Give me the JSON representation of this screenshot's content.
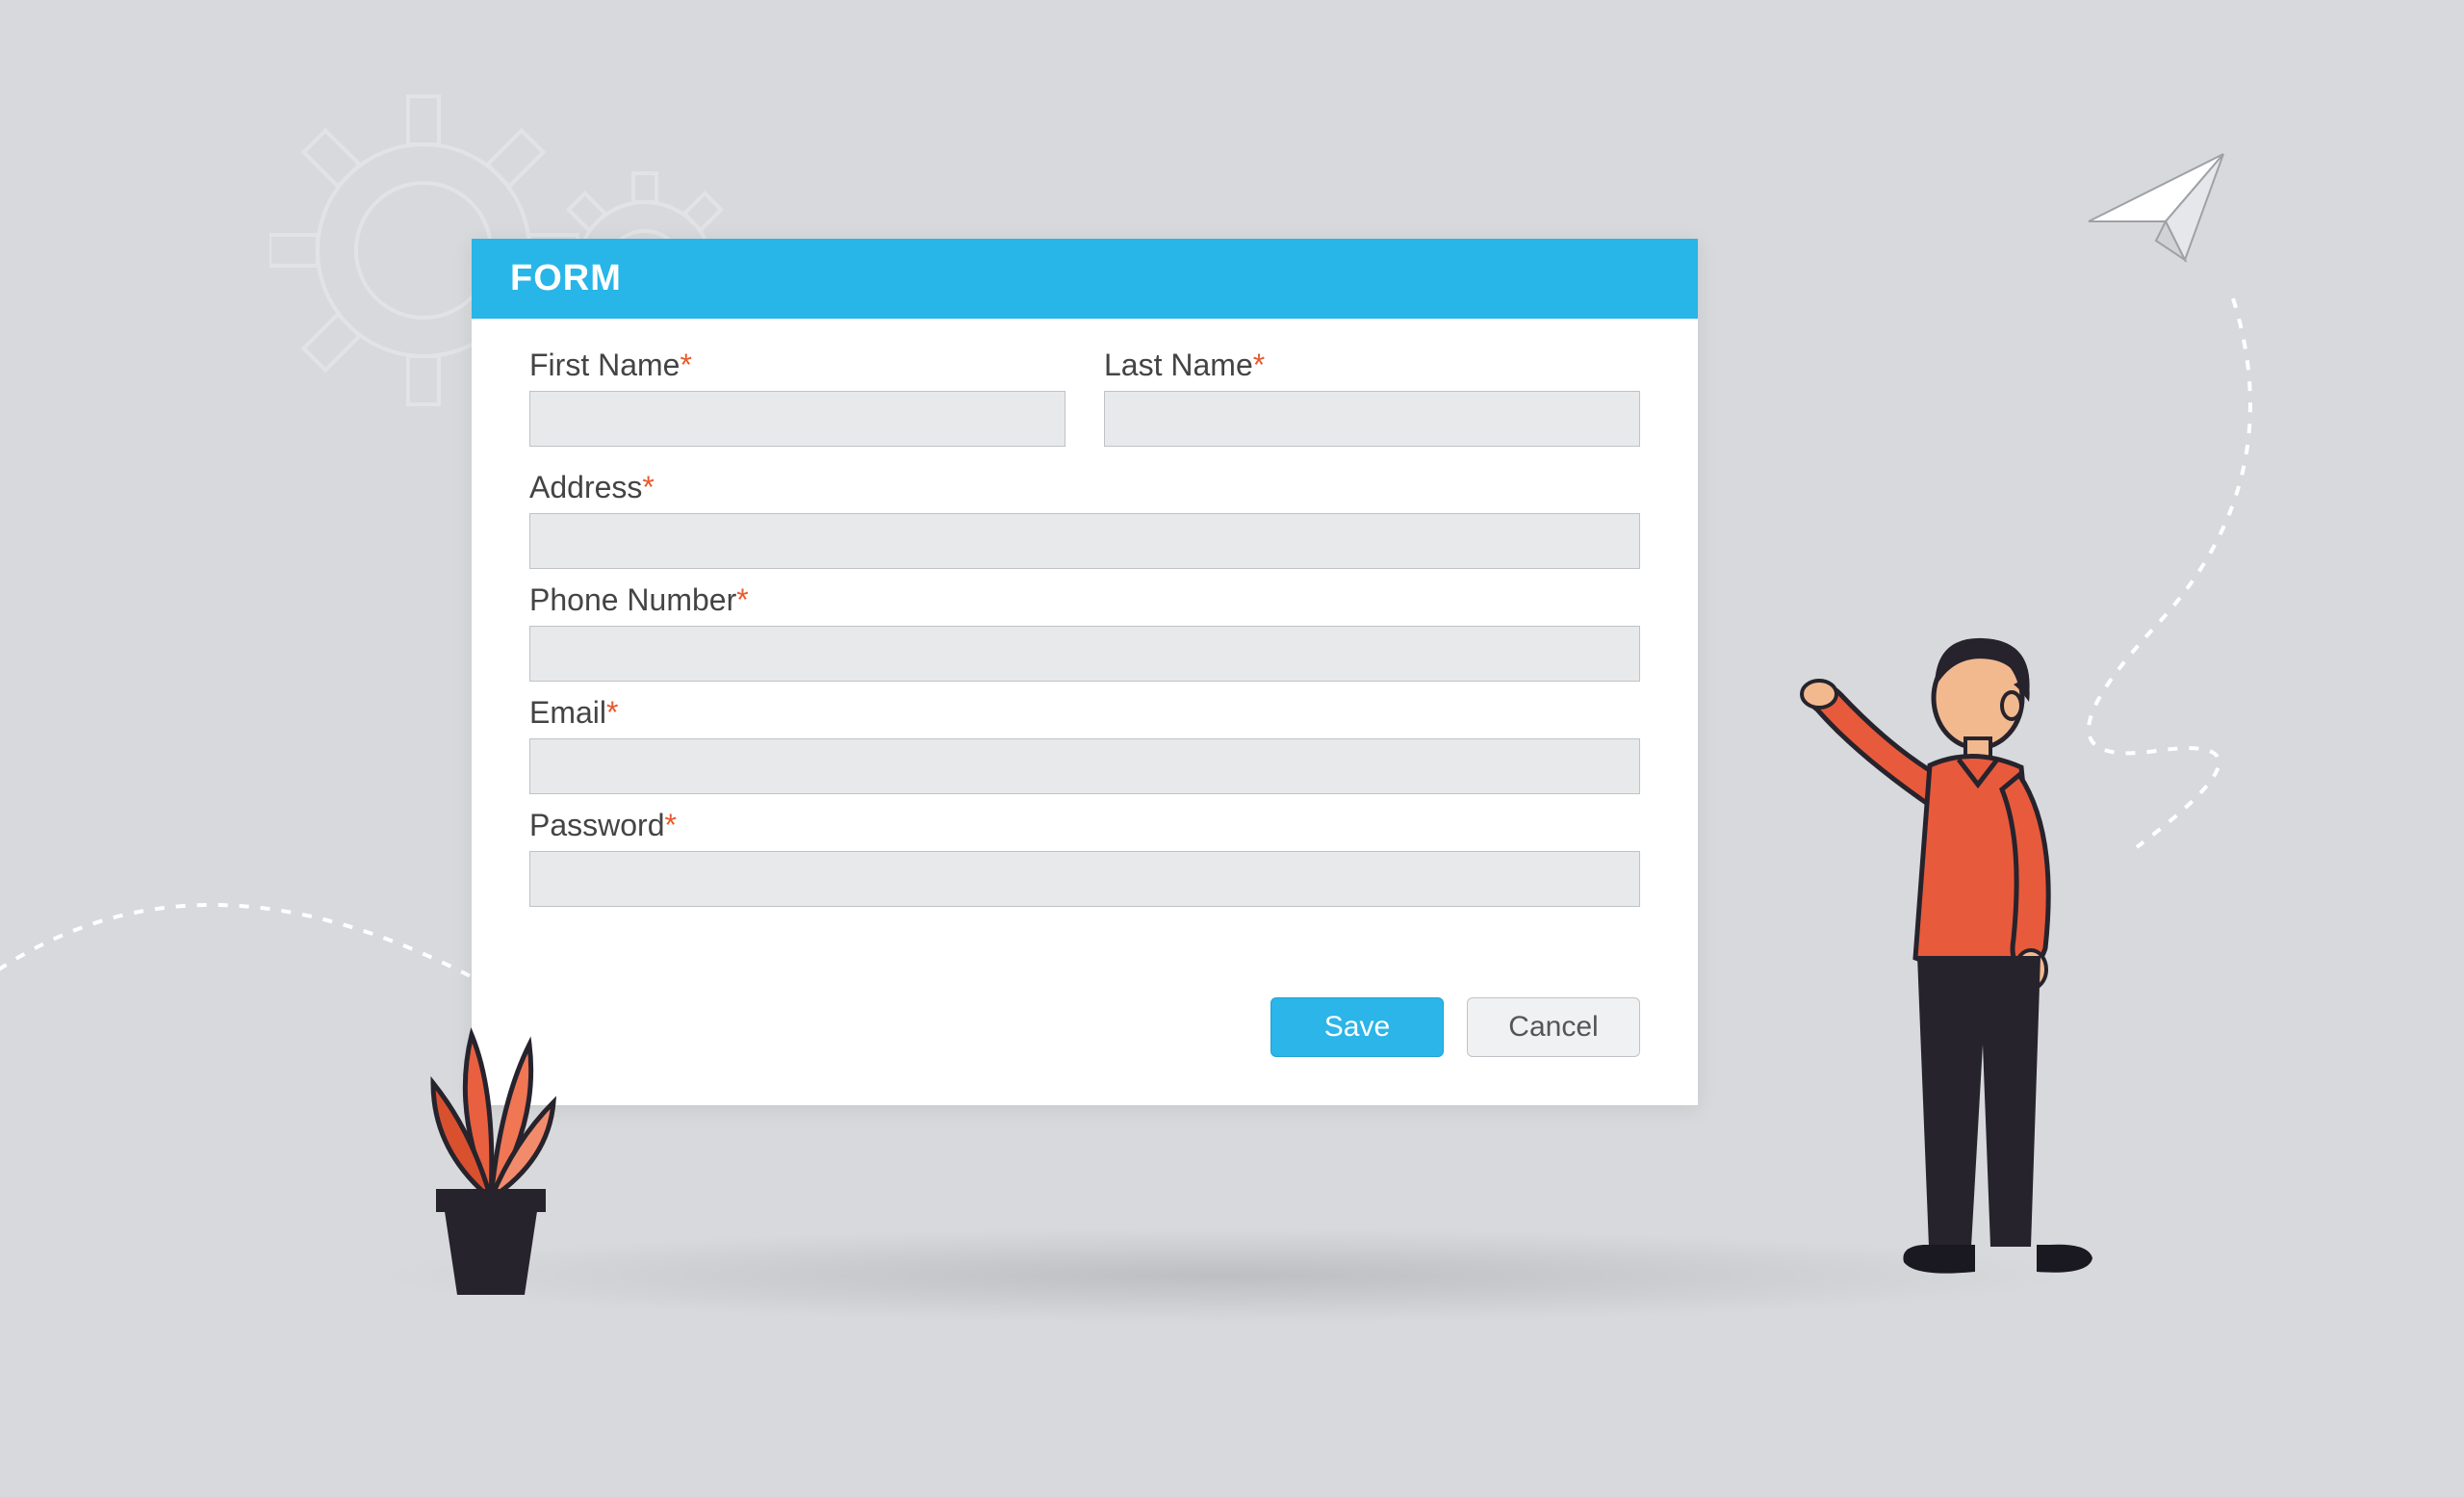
{
  "form": {
    "title": "FORM",
    "fields": {
      "first_name": {
        "label": "First Name",
        "required": "*",
        "value": ""
      },
      "last_name": {
        "label": "Last Name",
        "required": "*",
        "value": ""
      },
      "address": {
        "label": "Address",
        "required": "*",
        "value": ""
      },
      "phone": {
        "label": "Phone Number",
        "required": "*",
        "value": ""
      },
      "email": {
        "label": "Email",
        "required": "*",
        "value": ""
      },
      "password": {
        "label": "Password",
        "required": "*",
        "value": ""
      }
    },
    "buttons": {
      "save": "Save",
      "cancel": "Cancel"
    }
  },
  "colors": {
    "accent": "#28b5e8",
    "required": "#e85a2c",
    "input_bg": "#e8e9eb"
  }
}
